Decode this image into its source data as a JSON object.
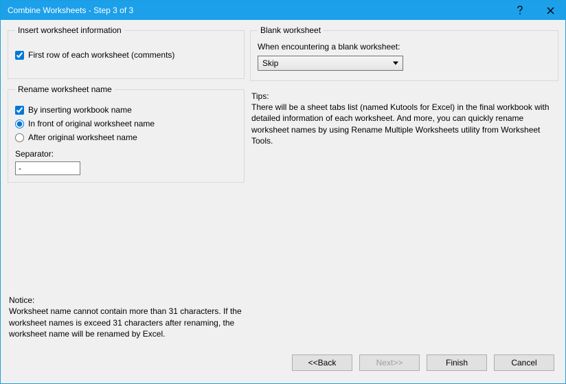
{
  "window": {
    "title": "Combine Worksheets - Step 3 of 3"
  },
  "insert": {
    "legend": "Insert worksheet information",
    "first_row_label": "First row of each worksheet (comments)"
  },
  "rename": {
    "legend": "Rename worksheet name",
    "by_inserting_label": "By inserting workbook name",
    "front_label": "In front of original worksheet name",
    "after_label": "After original worksheet name",
    "separator_label": "Separator:",
    "separator_value": "-"
  },
  "notice": {
    "title": "Notice:",
    "body": "Worksheet name cannot contain more than 31 characters. If the worksheet names is exceed 31 characters after renaming, the worksheet name will be renamed by Excel."
  },
  "blank": {
    "legend": "Blank worksheet",
    "label": "When encountering a blank worksheet:",
    "selected": "Skip"
  },
  "tips": {
    "title": "Tips:",
    "body": "There will be a sheet tabs list (named Kutools for Excel) in the final workbook with detailed information of each worksheet. And more, you can quickly rename worksheet names by using Rename Multiple Worksheets utility from Worksheet Tools."
  },
  "buttons": {
    "back": "<<Back",
    "next": "Next>>",
    "finish": "Finish",
    "cancel": "Cancel"
  }
}
